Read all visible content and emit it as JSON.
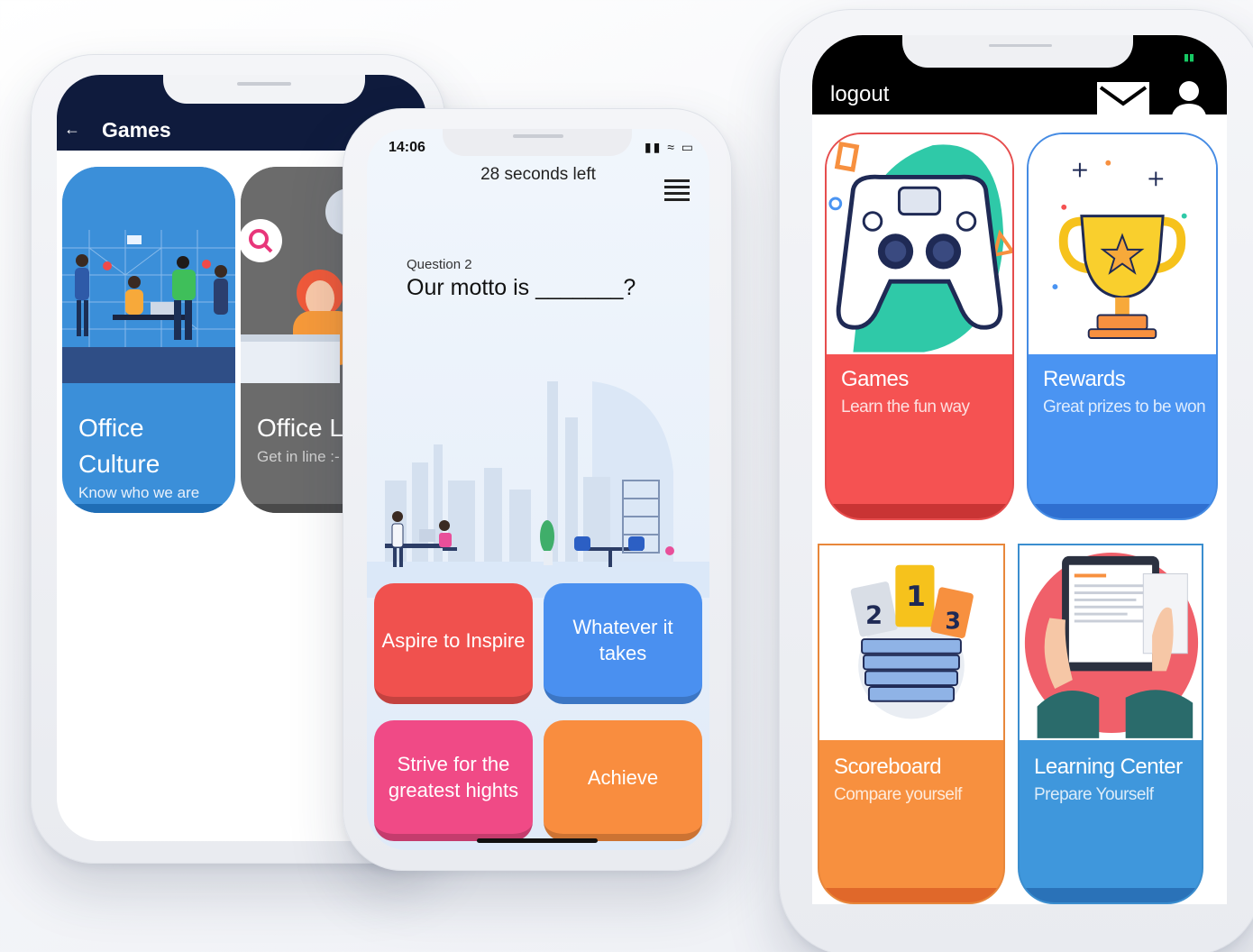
{
  "games_screen": {
    "title": "Games",
    "back_icon": "arrow-left-icon",
    "cards": [
      {
        "title_line1": "Office",
        "title_line2": "Culture",
        "subtitle": "Know who we are",
        "color": "#3b8fd9"
      },
      {
        "title_line1": "Office L",
        "title_line2": "",
        "subtitle": "Get in line :-",
        "color": "#6b6b6b"
      }
    ]
  },
  "quiz_screen": {
    "status_time": "14:06",
    "status_icons": "signal-wifi-battery-icons",
    "timer": "28 seconds left",
    "menu_icon": "hamburger-menu-icon",
    "question_number": "Question 2",
    "question_text": "Our motto is _______?",
    "answers": [
      {
        "label": "Aspire to Inspire",
        "color": "#f0514e"
      },
      {
        "label": "Whatever it takes",
        "color": "#4a90f0"
      },
      {
        "label": "Strive for the greatest hights",
        "color": "#f04a86"
      },
      {
        "label": "Achieve",
        "color": "#f98d3f"
      }
    ]
  },
  "dashboard_screen": {
    "logout_label": "logout",
    "mail_icon": "mail-icon",
    "user_icon": "user-icon",
    "tiles": [
      {
        "title": "Games",
        "subtitle": "Learn the fun way",
        "color": "#f55252",
        "icon": "gamepad-icon"
      },
      {
        "title": "Rewards",
        "subtitle": "Great prizes to be won",
        "color": "#4a94f2",
        "icon": "trophy-icon"
      },
      {
        "title": "Scoreboard",
        "subtitle": "Compare yourself",
        "color": "#f7903f",
        "icon": "podium-icon"
      },
      {
        "title": "Learning Center",
        "subtitle": "Prepare Yourself",
        "color": "#3f97dc",
        "icon": "tablet-book-icon"
      }
    ]
  }
}
